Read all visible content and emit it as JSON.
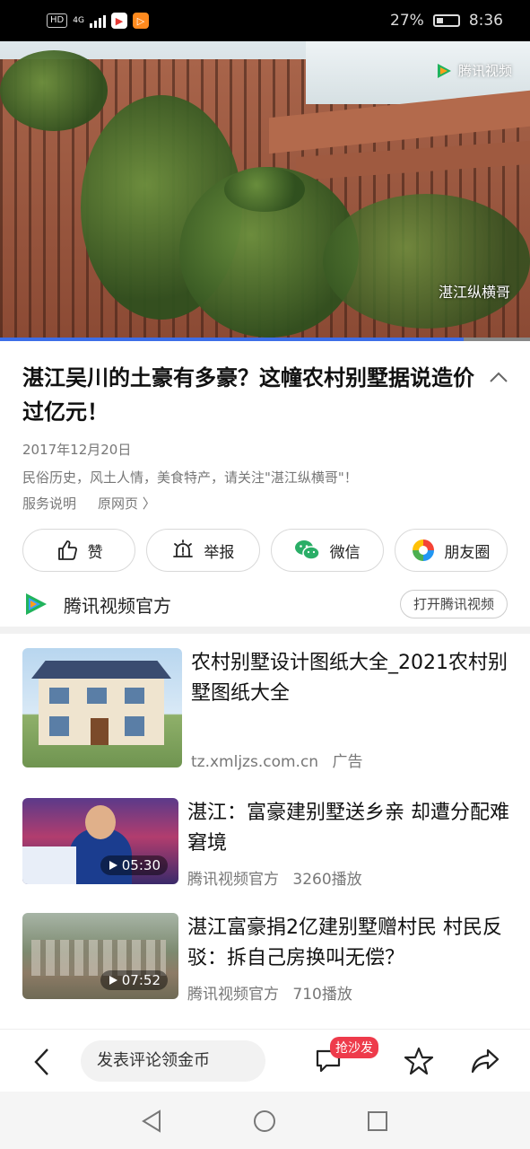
{
  "status_bar": {
    "network_chip": "HD",
    "network_type": "4G",
    "battery_percent": "27%",
    "time": "8:36"
  },
  "video": {
    "watermark": "腾讯视频",
    "caption": "湛江纵横哥",
    "progress": 0.875
  },
  "article": {
    "title": "湛江吴川的土豪有多豪？这幢农村别墅据说造价过亿元！",
    "date": "2017年12月20日",
    "description": "民俗历史，风土人情，美食特产，请关注\"湛江纵横哥\"！",
    "service_link": "服务说明",
    "original_link": "原网页 〉"
  },
  "actions": {
    "like": "赞",
    "report": "举报",
    "wechat": "微信",
    "moments": "朋友圈"
  },
  "source": {
    "name": "腾讯视频官方",
    "open_button": "打开腾讯视频"
  },
  "recommendations": [
    {
      "title": "农村别墅设计图纸大全_2021农村别墅图纸大全",
      "domain": "tz.xmljzs.com.cn",
      "tag": "广告"
    },
    {
      "title": "湛江：富豪建别墅送乡亲 却遭分配难窘境",
      "source": "腾讯视频官方",
      "plays": "3260播放",
      "duration": "05:30"
    },
    {
      "title": "湛江富豪捐2亿建别墅赠村民 村民反驳：拆自己房换叫无偿？",
      "source": "腾讯视频官方",
      "plays": "710播放",
      "duration": "07:52"
    }
  ],
  "bottom_bar": {
    "comment_placeholder": "发表评论领金币",
    "badge": "抢沙发"
  },
  "colors": {
    "progress": "#3d6ee8",
    "badge": "#ee3b4b",
    "wechat": "#2aae67"
  }
}
